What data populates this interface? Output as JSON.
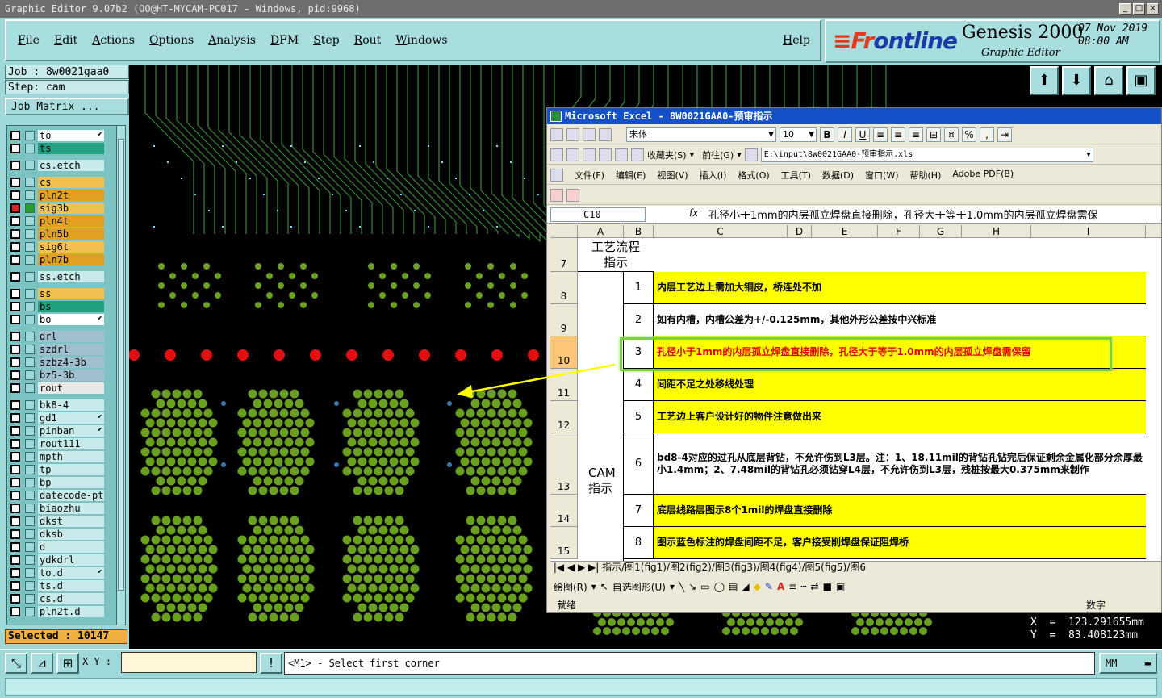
{
  "titlebar": {
    "text": "Graphic Editor 9.07b2 (OO@HT-MYCAM-PC017 - Windows, pid:9968)",
    "buttons": [
      "_",
      "□",
      "×"
    ]
  },
  "menu": {
    "items": [
      "File",
      "Edit",
      "Actions",
      "Options",
      "Analysis",
      "DFM",
      "Step",
      "Rout",
      "Windows"
    ],
    "help": "Help"
  },
  "brand": {
    "logo_prefix": "Fr",
    "logo_rest": "ontline",
    "product": "Genesis 2000",
    "subtitle": "Graphic Editor",
    "date": "07 Nov 2019",
    "time": "08:00 AM"
  },
  "job": {
    "job_line": "Job : 8w0021gaa0",
    "step_line": "Step: cam",
    "matrix_button": "Job Matrix ..."
  },
  "layers": [
    {
      "name": "to",
      "color": "#ffffff",
      "marker": "⬋",
      "checked": false,
      "group_start": false
    },
    {
      "name": "ts",
      "color": "#20a080",
      "marker": "",
      "checked": false,
      "group_start": false
    },
    {
      "name": "cs.etch",
      "color": "#c8eaea",
      "marker": "",
      "checked": false,
      "group_start": true
    },
    {
      "name": "cs",
      "color": "#f0c050",
      "marker": "",
      "checked": false,
      "group_start": true
    },
    {
      "name": "pln2t",
      "color": "#e0a020",
      "marker": "",
      "checked": false,
      "group_start": false
    },
    {
      "name": "sig3b",
      "color": "#f0c050",
      "marker": "",
      "checked": true,
      "group_start": false
    },
    {
      "name": "pln4t",
      "color": "#e0a020",
      "marker": "",
      "checked": false,
      "group_start": false
    },
    {
      "name": "pln5b",
      "color": "#e0a020",
      "marker": "",
      "checked": false,
      "group_start": false
    },
    {
      "name": "sig6t",
      "color": "#f0c050",
      "marker": "",
      "checked": false,
      "group_start": false
    },
    {
      "name": "pln7b",
      "color": "#e0a020",
      "marker": "",
      "checked": false,
      "group_start": false
    },
    {
      "name": "ss.etch",
      "color": "#c8eaea",
      "marker": "",
      "checked": false,
      "group_start": true
    },
    {
      "name": "ss",
      "color": "#f0c050",
      "marker": "",
      "checked": false,
      "group_start": true
    },
    {
      "name": "bs",
      "color": "#20a080",
      "marker": "",
      "checked": false,
      "group_start": false
    },
    {
      "name": "bo",
      "color": "#ffffff",
      "marker": "⬋",
      "checked": false,
      "group_start": false
    },
    {
      "name": "drl",
      "color": "#a0c0d0",
      "marker": "",
      "checked": false,
      "group_start": true
    },
    {
      "name": "szdrl",
      "color": "#a0c0d0",
      "marker": "",
      "checked": false,
      "group_start": false
    },
    {
      "name": "szbz4-3b",
      "color": "#a0c0d0",
      "marker": "",
      "checked": false,
      "group_start": false
    },
    {
      "name": "bz5-3b",
      "color": "#a0c0d0",
      "marker": "",
      "checked": false,
      "group_start": false
    },
    {
      "name": "rout",
      "color": "#e8e8e8",
      "marker": "",
      "checked": false,
      "group_start": false
    },
    {
      "name": "bk8-4",
      "color": "#c8eaea",
      "marker": "",
      "checked": false,
      "group_start": true
    },
    {
      "name": "gd1",
      "color": "#c8eaea",
      "marker": "⬋",
      "checked": false,
      "group_start": false
    },
    {
      "name": "pinban",
      "color": "#c8eaea",
      "marker": "⬋",
      "checked": false,
      "group_start": false
    },
    {
      "name": "rout111",
      "color": "#c8eaea",
      "marker": "",
      "checked": false,
      "group_start": false
    },
    {
      "name": "mpth",
      "color": "#c8eaea",
      "marker": "",
      "checked": false,
      "group_start": false
    },
    {
      "name": "tp",
      "color": "#c8eaea",
      "marker": "",
      "checked": false,
      "group_start": false
    },
    {
      "name": "bp",
      "color": "#c8eaea",
      "marker": "",
      "checked": false,
      "group_start": false
    },
    {
      "name": "datecode-pte",
      "color": "#c8eaea",
      "marker": "",
      "checked": false,
      "group_start": false
    },
    {
      "name": "biaozhu",
      "color": "#c8eaea",
      "marker": "",
      "checked": false,
      "group_start": false
    },
    {
      "name": "dkst",
      "color": "#c8eaea",
      "marker": "",
      "checked": false,
      "group_start": false
    },
    {
      "name": "dksb",
      "color": "#c8eaea",
      "marker": "",
      "checked": false,
      "group_start": false
    },
    {
      "name": "d",
      "color": "#c8eaea",
      "marker": "",
      "checked": false,
      "group_start": false
    },
    {
      "name": "ydkdrl",
      "color": "#c8eaea",
      "marker": "",
      "checked": false,
      "group_start": false
    },
    {
      "name": "to.d",
      "color": "#c8eaea",
      "marker": "⬋",
      "checked": false,
      "group_start": false
    },
    {
      "name": "ts.d",
      "color": "#c8eaea",
      "marker": "",
      "checked": false,
      "group_start": false
    },
    {
      "name": "cs.d",
      "color": "#c8eaea",
      "marker": "",
      "checked": false,
      "group_start": false
    },
    {
      "name": "pln2t.d",
      "color": "#c8eaea",
      "marker": "",
      "checked": false,
      "group_start": false
    }
  ],
  "selected": "Selected : 10147",
  "coords": {
    "x": "X  =  123.291655mm",
    "y": "Y  =  83.408123mm"
  },
  "bottom": {
    "xy_label": "X Y :",
    "xy_value": "",
    "message": "<M1> - Select first corner",
    "units": "MM"
  },
  "excel": {
    "title": "Microsoft Excel - 8W0021GAA0-预审指示",
    "font_name": "宋体",
    "font_size": "10",
    "favorites": "收藏夹(S)",
    "goto": "前往(G)",
    "path": "E:\\input\\8W0021GAA0-预审指示.xls",
    "menus": [
      "文件(F)",
      "编辑(E)",
      "视图(V)",
      "插入(I)",
      "格式(O)",
      "工具(T)",
      "数据(D)",
      "窗口(W)",
      "帮助(H)",
      "Adobe PDF(B)"
    ],
    "name_box": "C10",
    "formula": "孔径小于1mm的内层孤立焊盘直接删除，孔径大于等于1.0mm的内层孤立焊盘需保",
    "columns": [
      "A",
      "B",
      "C",
      "D",
      "E",
      "F",
      "G",
      "H",
      "I"
    ],
    "header_cell": "工艺流程指示",
    "group_label": "CAM指示",
    "rows": [
      {
        "row": "7",
        "num": "",
        "text": "",
        "yellow": false
      },
      {
        "row": "8",
        "num": "1",
        "text": "内层工艺边上需加大铜皮，桥连处不加",
        "yellow": true
      },
      {
        "row": "9",
        "num": "2",
        "text": "如有内槽，内槽公差为+/-0.125mm，其他外形公差按中兴标准",
        "yellow": false
      },
      {
        "row": "10",
        "num": "3",
        "text": "孔径小于1mm的内层孤立焊盘直接删除，孔径大于等于1.0mm的内层孤立焊盘需保留",
        "yellow": true
      },
      {
        "row": "11",
        "num": "4",
        "text": "间距不足之处移线处理",
        "yellow": true
      },
      {
        "row": "12",
        "num": "5",
        "text": "工艺边上客户设计好的物件注意做出来",
        "yellow": true
      },
      {
        "row": "13",
        "num": "6",
        "text": "bd8-4对应的过孔从底层背钻，不允许伤到L3层。注：1、18.11mil的背钻孔钻完后保证剩余金属化部分余厚最小1.4mm；2、7.48mil的背钻孔必须钻穿L4层，不允许伤到L3层，残桩按最大0.375mm来制作",
        "yellow": false
      },
      {
        "row": "14",
        "num": "7",
        "text": "底层线路层图示8个1mil的焊盘直接删除",
        "yellow": true
      },
      {
        "row": "15",
        "num": "8",
        "text": "图示蓝色标注的焊盘间距不足，客户接受削焊盘保证阻焊桥",
        "yellow": true
      }
    ],
    "sheet_tabs": "指示/图1(fig1)/图2(fig2)/图3(fig3)/图4(fig4)/图5(fig5)/图6",
    "draw_label": "绘图(R)",
    "autoshape": "自选图形(U)",
    "status": "就绪",
    "status_right": "数字"
  }
}
